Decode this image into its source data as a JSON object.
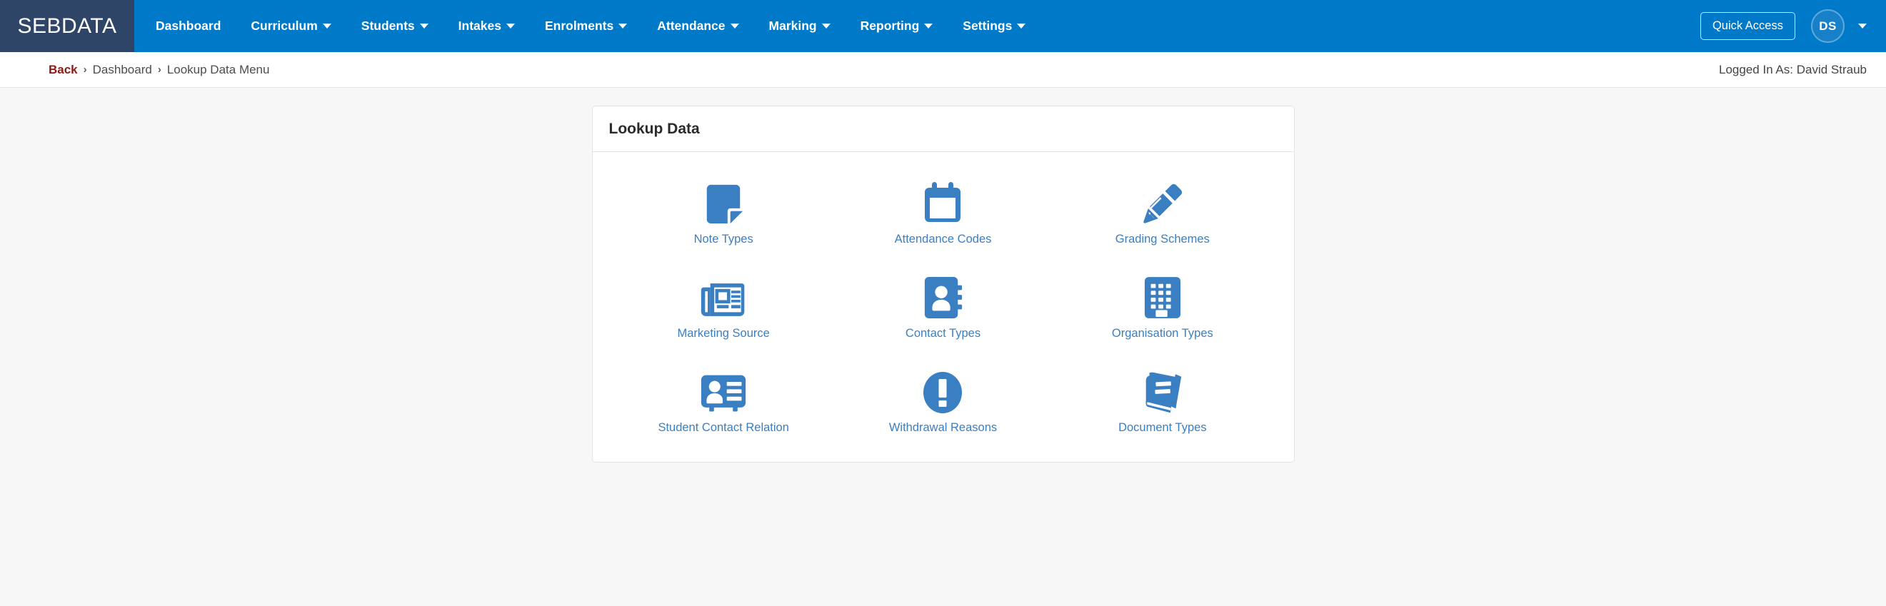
{
  "navbar": {
    "brand": "SEBDATA",
    "items": [
      {
        "label": "Dashboard",
        "has_caret": false
      },
      {
        "label": "Curriculum",
        "has_caret": true
      },
      {
        "label": "Students",
        "has_caret": true
      },
      {
        "label": "Intakes",
        "has_caret": true
      },
      {
        "label": "Enrolments",
        "has_caret": true
      },
      {
        "label": "Attendance",
        "has_caret": true
      },
      {
        "label": "Marking",
        "has_caret": true
      },
      {
        "label": "Reporting",
        "has_caret": true
      },
      {
        "label": "Settings",
        "has_caret": true
      }
    ],
    "quick_access_label": "Quick Access",
    "avatar_initials": "DS",
    "colors": {
      "navbar_blue": "#0079c8",
      "brand_navy": "#2f4568",
      "avatar_fill": "#1780c9"
    }
  },
  "breadcrumb": {
    "back_label": "Back",
    "separator": "›",
    "items": [
      {
        "label": "Dashboard"
      },
      {
        "label": "Lookup Data Menu"
      }
    ],
    "logged_in_as": "Logged In As: David Straub",
    "back_color": "#8b1a17"
  },
  "card": {
    "title": "Lookup Data",
    "icon_color": "#3a7fc1",
    "link_color": "#3a7fc1",
    "tiles": [
      {
        "label": "Note Types",
        "icon": "sticky-note-icon"
      },
      {
        "label": "Attendance Codes",
        "icon": "calendar-icon"
      },
      {
        "label": "Grading Schemes",
        "icon": "pencil-icon"
      },
      {
        "label": "Marketing Source",
        "icon": "newspaper-icon"
      },
      {
        "label": "Contact Types",
        "icon": "address-book-icon"
      },
      {
        "label": "Organisation Types",
        "icon": "building-icon"
      },
      {
        "label": "Student Contact Relation",
        "icon": "id-card-icon"
      },
      {
        "label": "Withdrawal Reasons",
        "icon": "exclamation-circle-icon"
      },
      {
        "label": "Document Types",
        "icon": "book-icon"
      }
    ]
  }
}
